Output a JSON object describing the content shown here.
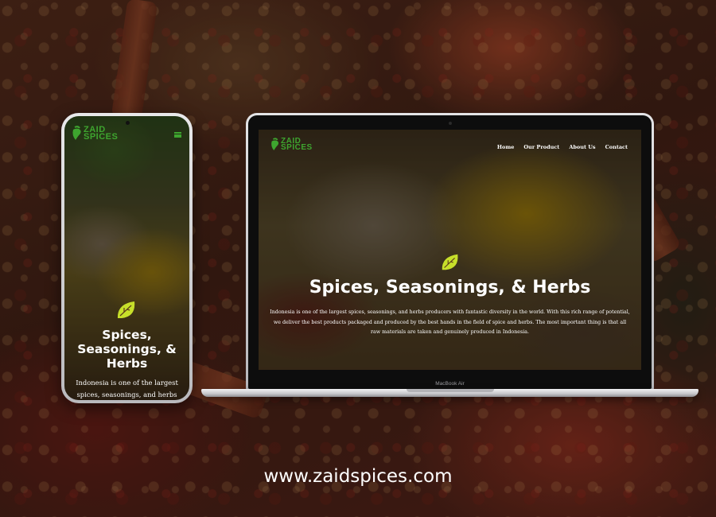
{
  "brand": {
    "logo_word_1": "ZAID",
    "logo_word_2": "SPICES",
    "logo_color": "#3ea52f",
    "leaf_color": "#c7df2a"
  },
  "laptop": {
    "label": "MacBook Air",
    "nav": {
      "home": "Home",
      "our_product": "Our Product",
      "about_us": "About Us",
      "contact": "Contact"
    },
    "hero_icon": "leaf-icon",
    "title": "Spices, Seasonings, & Herbs",
    "description": "Indonesia is one of the largest spices, seasonings, and herbs producers with fantastic diversity in the world. With this rich range of potential, we deliver the best products packaged and produced by the best hands in the field of spice and herbs. The most important thing is that all raw materials are taken and genuinely produced in Indonesia."
  },
  "phone": {
    "menu_icon": "hamburger-menu-icon",
    "hero_icon": "leaf-icon",
    "title_line_1": "Spices,",
    "title_line_2": "Seasonings, &",
    "title_line_3": "Herbs",
    "description_line_1": "Indonesia is one of the largest",
    "description_line_2": "spices, seasonings, and herbs"
  },
  "footer": {
    "url": "www.zaidspices.com"
  }
}
